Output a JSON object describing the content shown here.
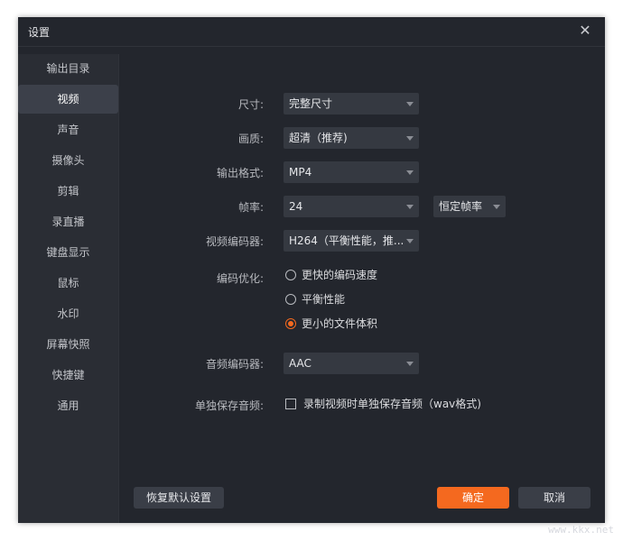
{
  "window": {
    "title": "设置",
    "close_glyph": "✕"
  },
  "sidebar": {
    "items": [
      {
        "label": "输出目录"
      },
      {
        "label": "视频"
      },
      {
        "label": "声音"
      },
      {
        "label": "摄像头"
      },
      {
        "label": "剪辑"
      },
      {
        "label": "录直播"
      },
      {
        "label": "键盘显示"
      },
      {
        "label": "鼠标"
      },
      {
        "label": "水印"
      },
      {
        "label": "屏幕快照"
      },
      {
        "label": "快捷键"
      },
      {
        "label": "通用"
      }
    ],
    "active_index": 1
  },
  "video": {
    "size": {
      "label": "尺寸:",
      "value": "完整尺寸"
    },
    "quality": {
      "label": "画质:",
      "value": "超清（推荐)"
    },
    "format": {
      "label": "输出格式:",
      "value": "MP4"
    },
    "framerate": {
      "label": "帧率:",
      "value": "24",
      "mode": "恒定帧率"
    },
    "encoder": {
      "label": "视频编码器:",
      "value": "H264（平衡性能，推..."
    },
    "optimize": {
      "label": "编码优化:",
      "options": [
        "更快的编码速度",
        "平衡性能",
        "更小的文件体积"
      ],
      "selected_index": 2
    },
    "audio_encoder": {
      "label": "音频编码器:",
      "value": "AAC"
    },
    "separate_audio": {
      "label": "单独保存音频:",
      "checkbox_text": "录制视频时单独保存音频（wav格式)",
      "checked": false
    }
  },
  "buttons": {
    "restore": "恢复默认设置",
    "ok": "确定",
    "cancel": "取消"
  },
  "watermark": "www.kkx.net",
  "colors": {
    "accent": "#f4691f",
    "background": "#23262d",
    "sidebar": "#2a2d34",
    "active_item": "#3c404a"
  }
}
